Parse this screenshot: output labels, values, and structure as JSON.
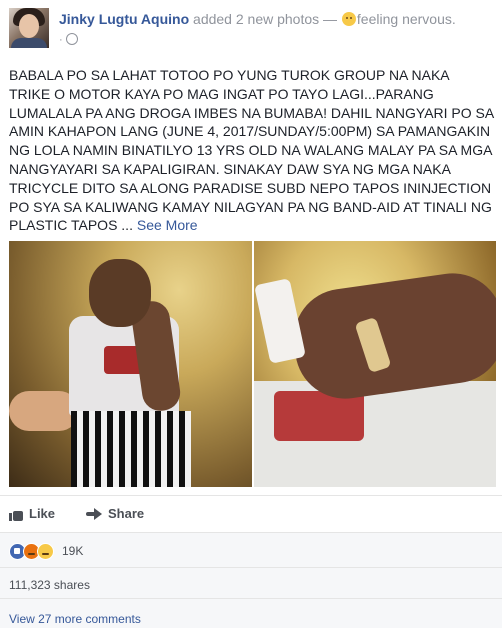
{
  "post": {
    "author": "Jinky Lugtu Aquino",
    "action_text": " added 2 new photos — ",
    "feeling": "feeling nervous.",
    "meta_separator": "·",
    "text_lines": [
      "BABALA PO SA LAHAT TOTOO PO YUNG TUROK GROUP NA NAKA",
      "TRIKE O MOTOR KAYA PO MAG INGAT PO TAYO LAGI...PARANG",
      "LUMALALA PA ANG DROGA IMBES NA BUMABA! DAHIL NANGYARI PO SA",
      "AMIN KAHAPON LANG (JUNE 4, 2017/SUNDAY/5:00PM) SA PAMANGAKIN",
      "NG LOLA NAMIN BINATILYO 13 YRS OLD NA WALANG MALAY PA SA MGA",
      "NANGYAYARI SA KAPALIGIRAN. SINAKAY DAW SYA NG MGA NAKA",
      "TRICYCLE DITO SA ALONG PARADISE SUBD NEPO TAPOS ININJECTION",
      "PO SYA SA KALIWANG KAMAY NILAGYAN PA NG BAND-AID AT TINALI NG",
      "PLASTIC TAPOS ... "
    ],
    "see_more": "See More"
  },
  "actions": {
    "like": "Like",
    "share": "Share"
  },
  "reactions": {
    "count": "19K",
    "types": [
      "like",
      "angry",
      "sad"
    ]
  },
  "shares": "111,323 shares",
  "comments": {
    "view_more": "View 27 more comments"
  },
  "colors": {
    "link": "#365899",
    "text": "#1d2129",
    "muted": "#90949c",
    "bar_bg": "#f6f7f9"
  },
  "icons": [
    "avatar",
    "feeling-nervous-emoji",
    "globe-icon",
    "like-icon",
    "share-icon",
    "like-reaction-icon",
    "angry-reaction-icon",
    "sad-reaction-icon"
  ]
}
